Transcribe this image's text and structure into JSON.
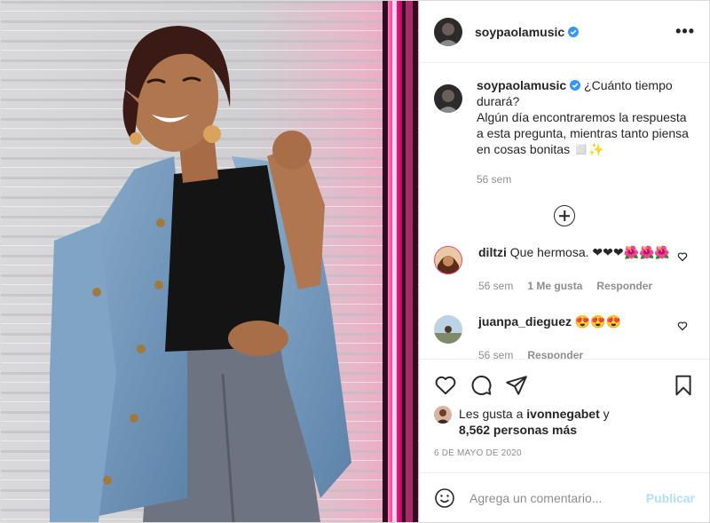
{
  "header": {
    "username": "soypaolamusic",
    "verified": true,
    "more_label": "•••"
  },
  "caption": {
    "username": "soypaolamusic",
    "text": "¿Cuánto tiempo durará?\nAlgún día encontraremos la respuesta a esta pregunta, mientras tanto piensa en cosas bonitas ◻️✨",
    "time": "56 sem"
  },
  "comments": [
    {
      "username": "diltzi",
      "text": "Que hermosa. ❤❤❤🌺🌺🌺",
      "time": "56 sem",
      "likes": "1 Me gusta",
      "reply": "Responder"
    },
    {
      "username": "juanpa_dieguez",
      "text": "😍😍😍",
      "time": "56 sem",
      "reply": "Responder"
    }
  ],
  "likes": {
    "prefix": "Les gusta a",
    "user": "ivonnegabet",
    "conj": "y",
    "others": "8,562 personas más"
  },
  "date": "6 DE MAYO DE 2020",
  "comment_box": {
    "placeholder": "Agrega un comentario...",
    "publish_label": "Publicar"
  },
  "icons": {
    "like": "heart-icon",
    "comment": "comment-icon",
    "share": "paper-plane-icon",
    "save": "bookmark-icon",
    "emoji": "smiley-icon",
    "load_more": "plus-circle-icon",
    "verified": "verified-badge-icon"
  },
  "colors": {
    "verified": "#3897f0",
    "publish_disabled": "#b2dffc",
    "muted": "#8e8e8e",
    "neon": "#ff2d8a"
  }
}
